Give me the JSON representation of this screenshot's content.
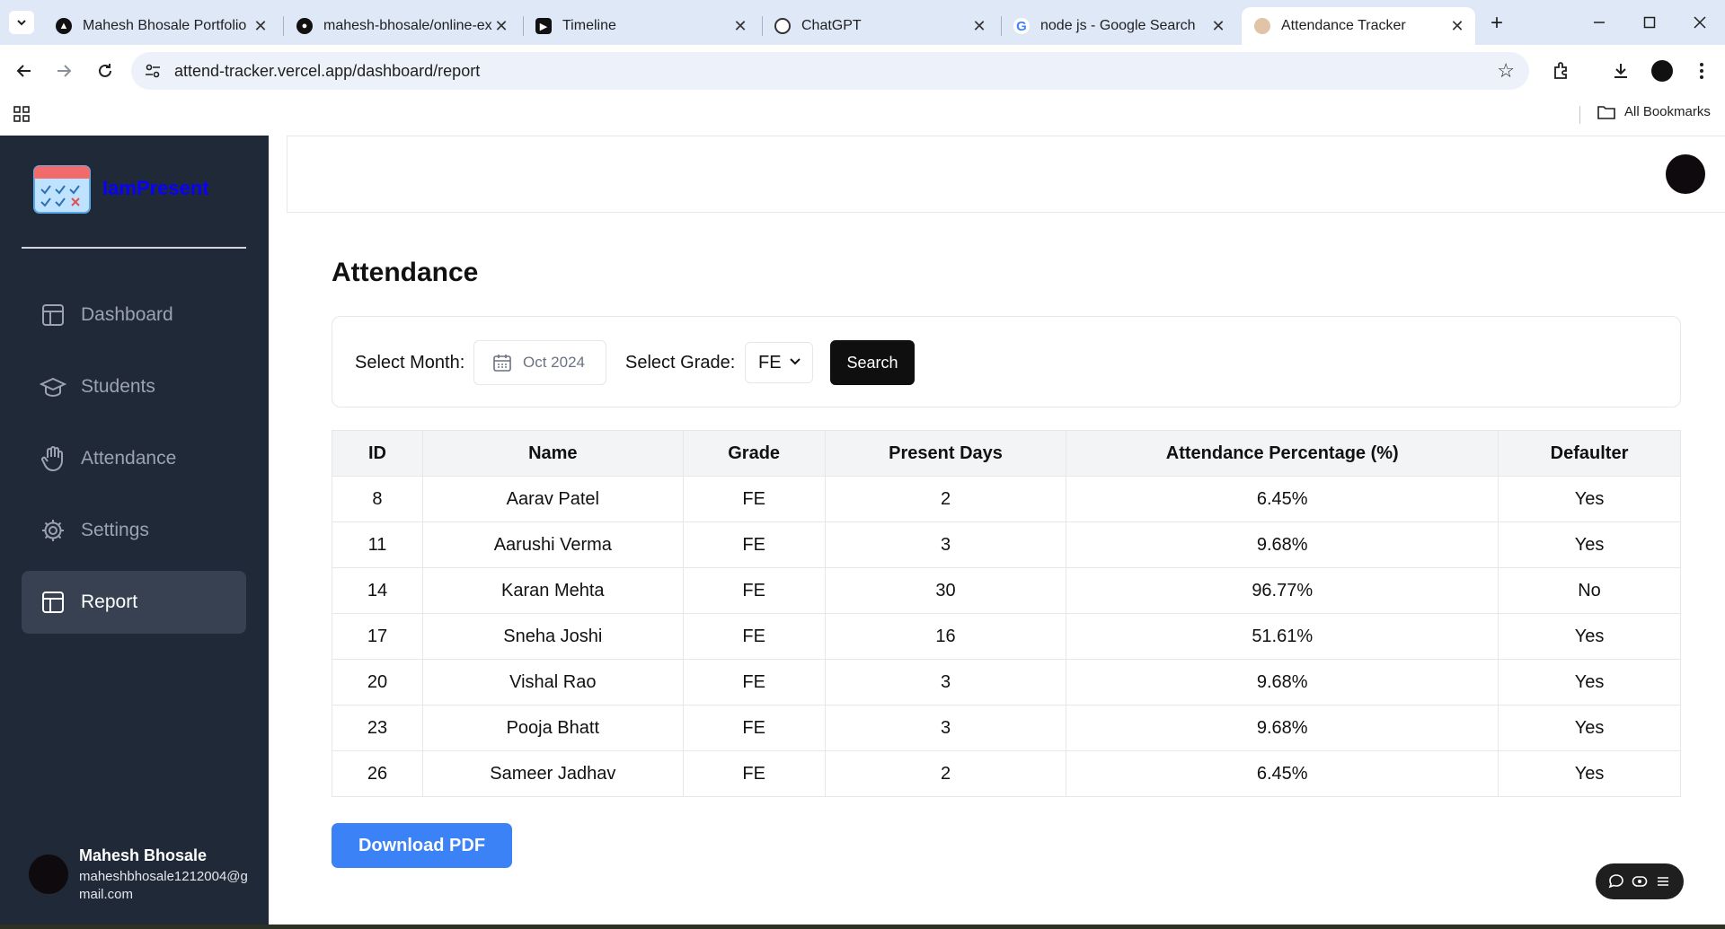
{
  "browser": {
    "tabs": [
      {
        "title": "Mahesh Bhosale Portfolio",
        "favicon": "triangle-logo-icon"
      },
      {
        "title": "mahesh-bhosale/online-ex",
        "favicon": "github-icon"
      },
      {
        "title": "Timeline",
        "favicon": "play-icon"
      },
      {
        "title": "ChatGPT",
        "favicon": "chatgpt-icon"
      },
      {
        "title": "node js - Google Search",
        "favicon": "google-icon"
      },
      {
        "title": "Attendance Tracker",
        "favicon": "user-icon"
      }
    ],
    "active_tab": 5,
    "url": "attend-tracker.vercel.app/dashboard/report",
    "bookmarks_label": "All Bookmarks",
    "close_glyph": "✕",
    "newtab_glyph": "+"
  },
  "sidebar": {
    "brand": "IamPresent",
    "items": [
      {
        "label": "Dashboard",
        "icon": "layout-icon"
      },
      {
        "label": "Students",
        "icon": "graduation-cap-icon"
      },
      {
        "label": "Attendance",
        "icon": "hand-icon"
      },
      {
        "label": "Settings",
        "icon": "gear-icon"
      },
      {
        "label": "Report",
        "icon": "layout-icon"
      }
    ],
    "active_item": 4,
    "user": {
      "name": "Mahesh Bhosale",
      "email": "maheshbhosale1212004@gmail.com"
    }
  },
  "page": {
    "title": "Attendance",
    "filters": {
      "month_label": "Select Month:",
      "month_value": "Oct 2024",
      "grade_label": "Select Grade:",
      "grade_value": "FE",
      "search_label": "Search"
    },
    "table": {
      "headers": [
        "ID",
        "Name",
        "Grade",
        "Present Days",
        "Attendance Percentage (%)",
        "Defaulter"
      ],
      "rows": [
        [
          "8",
          "Aarav Patel",
          "FE",
          "2",
          "6.45%",
          "Yes"
        ],
        [
          "11",
          "Aarushi Verma",
          "FE",
          "3",
          "9.68%",
          "Yes"
        ],
        [
          "14",
          "Karan Mehta",
          "FE",
          "30",
          "96.77%",
          "No"
        ],
        [
          "17",
          "Sneha Joshi",
          "FE",
          "16",
          "51.61%",
          "Yes"
        ],
        [
          "20",
          "Vishal Rao",
          "FE",
          "3",
          "9.68%",
          "Yes"
        ],
        [
          "23",
          "Pooja Bhatt",
          "FE",
          "3",
          "9.68%",
          "Yes"
        ],
        [
          "26",
          "Sameer Jadhav",
          "FE",
          "2",
          "6.45%",
          "Yes"
        ]
      ]
    },
    "download_label": "Download PDF"
  },
  "colors": {
    "sidebar_bg": "#1f2937",
    "active_item_bg": "#374151",
    "brand": "#0a00ff",
    "primary_button": "#3b82f6",
    "search_button": "#0f0f0f"
  }
}
